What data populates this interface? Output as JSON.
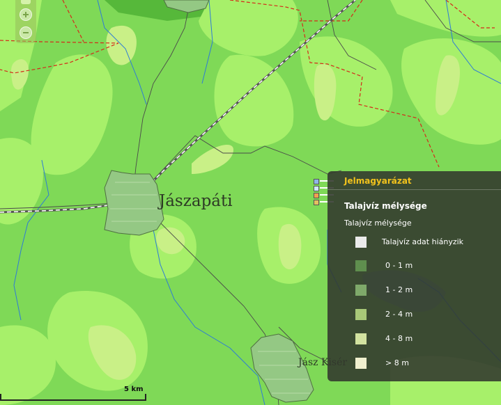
{
  "map": {
    "town_main": "Jászapáti",
    "town_secondary": "Jász Kisér",
    "colors": {
      "base_green": "#7fd957",
      "light_green": "#a7f06a",
      "pale_green": "#c9f087",
      "settlement": "#94c884",
      "border_red": "#d42a1a",
      "water_blue": "#2e7bd6",
      "road_gray": "#4a4a4a",
      "rail_white": "#ffffff"
    }
  },
  "controls": {
    "zoom_in_icon": "plus-icon",
    "zoom_out_icon": "minus-icon"
  },
  "scale": {
    "label": "5 km"
  },
  "legend": {
    "header": "Jelmagyarázat",
    "layer_title": "Talajvíz mélysége",
    "sub_title": "Talajvíz mélysége",
    "items": [
      {
        "label": "Talajvíz adat hiányzik",
        "color": "#ebebeb"
      },
      {
        "label": "0 - 1 m",
        "color": "#5f8f4e"
      },
      {
        "label": "1 - 2 m",
        "color": "#7fa96a"
      },
      {
        "label": "2 - 4 m",
        "color": "#a8c878"
      },
      {
        "label": "4 - 8 m",
        "color": "#d2e2a0"
      },
      {
        "label": "> 8 m",
        "color": "#f0f0cf"
      }
    ]
  }
}
